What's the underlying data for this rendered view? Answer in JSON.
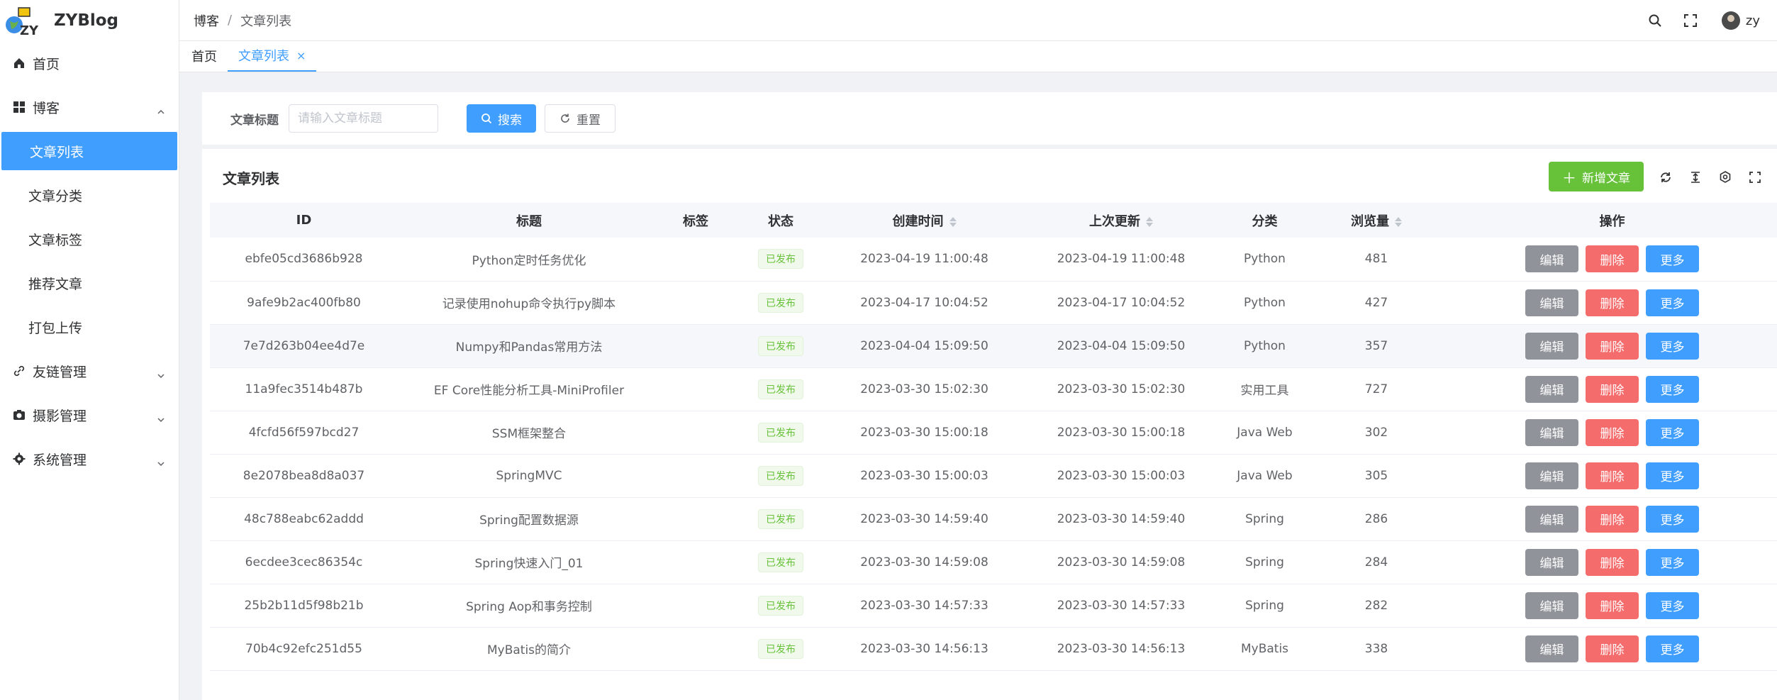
{
  "app": {
    "title": "ZYBlog"
  },
  "colors": {
    "primary": "#409eff",
    "success": "#67c23a",
    "danger": "#f56c6c",
    "info": "#909399"
  },
  "sidebar": {
    "home": "首页",
    "blog_group": "博客",
    "blog_items": [
      "文章列表",
      "文章分类",
      "文章标签",
      "推荐文章",
      "打包上传"
    ],
    "groups": [
      "友链管理",
      "摄影管理",
      "系统管理"
    ]
  },
  "header": {
    "breadcrumb": [
      "博客",
      "文章列表"
    ],
    "breadcrumb_sep": "/",
    "user": "zy"
  },
  "tabs": {
    "home": "首页",
    "active": "文章列表",
    "close": "×"
  },
  "search": {
    "label": "文章标题",
    "placeholder": "请输入文章标题",
    "search_btn": "搜索",
    "reset_btn": "重置"
  },
  "table": {
    "title": "文章列表",
    "add_btn": "新增文章",
    "columns": [
      "ID",
      "标题",
      "标签",
      "状态",
      "创建时间",
      "上次更新",
      "分类",
      "浏览量",
      "操作"
    ],
    "actions": {
      "edit": "编辑",
      "delete": "删除",
      "more": "更多"
    },
    "rows": [
      {
        "id": "ebfe05cd3686b928",
        "title": "Python定时任务优化",
        "tags": "",
        "status": "已发布",
        "created": "2023-04-19 11:00:48",
        "updated": "2023-04-19 11:00:48",
        "category": "Python",
        "views": "481"
      },
      {
        "id": "9afe9b2ac400fb80",
        "title": "记录使用nohup命令执行py脚本",
        "tags": "",
        "status": "已发布",
        "created": "2023-04-17 10:04:52",
        "updated": "2023-04-17 10:04:52",
        "category": "Python",
        "views": "427"
      },
      {
        "id": "7e7d263b04ee4d7e",
        "title": "Numpy和Pandas常用方法",
        "tags": "",
        "status": "已发布",
        "created": "2023-04-04 15:09:50",
        "updated": "2023-04-04 15:09:50",
        "category": "Python",
        "views": "357"
      },
      {
        "id": "11a9fec3514b487b",
        "title": "EF Core性能分析工具-MiniProfiler",
        "tags": "",
        "status": "已发布",
        "created": "2023-03-30 15:02:30",
        "updated": "2023-03-30 15:02:30",
        "category": "实用工具",
        "views": "727"
      },
      {
        "id": "4fcfd56f597bcd27",
        "title": "SSM框架整合",
        "tags": "",
        "status": "已发布",
        "created": "2023-03-30 15:00:18",
        "updated": "2023-03-30 15:00:18",
        "category": "Java Web",
        "views": "302"
      },
      {
        "id": "8e2078bea8d8a037",
        "title": "SpringMVC",
        "tags": "",
        "status": "已发布",
        "created": "2023-03-30 15:00:03",
        "updated": "2023-03-30 15:00:03",
        "category": "Java Web",
        "views": "305"
      },
      {
        "id": "48c788eabc62addd",
        "title": "Spring配置数据源",
        "tags": "",
        "status": "已发布",
        "created": "2023-03-30 14:59:40",
        "updated": "2023-03-30 14:59:40",
        "category": "Spring",
        "views": "286"
      },
      {
        "id": "6ecdee3cec86354c",
        "title": "Spring快速入门_01",
        "tags": "",
        "status": "已发布",
        "created": "2023-03-30 14:59:08",
        "updated": "2023-03-30 14:59:08",
        "category": "Spring",
        "views": "284"
      },
      {
        "id": "25b2b11d5f98b21b",
        "title": "Spring Aop和事务控制",
        "tags": "",
        "status": "已发布",
        "created": "2023-03-30 14:57:33",
        "updated": "2023-03-30 14:57:33",
        "category": "Spring",
        "views": "282"
      },
      {
        "id": "70b4c92efc251d55",
        "title": "MyBatis的简介",
        "tags": "",
        "status": "已发布",
        "created": "2023-03-30 14:56:13",
        "updated": "2023-03-30 14:56:13",
        "category": "MyBatis",
        "views": "338"
      }
    ]
  }
}
